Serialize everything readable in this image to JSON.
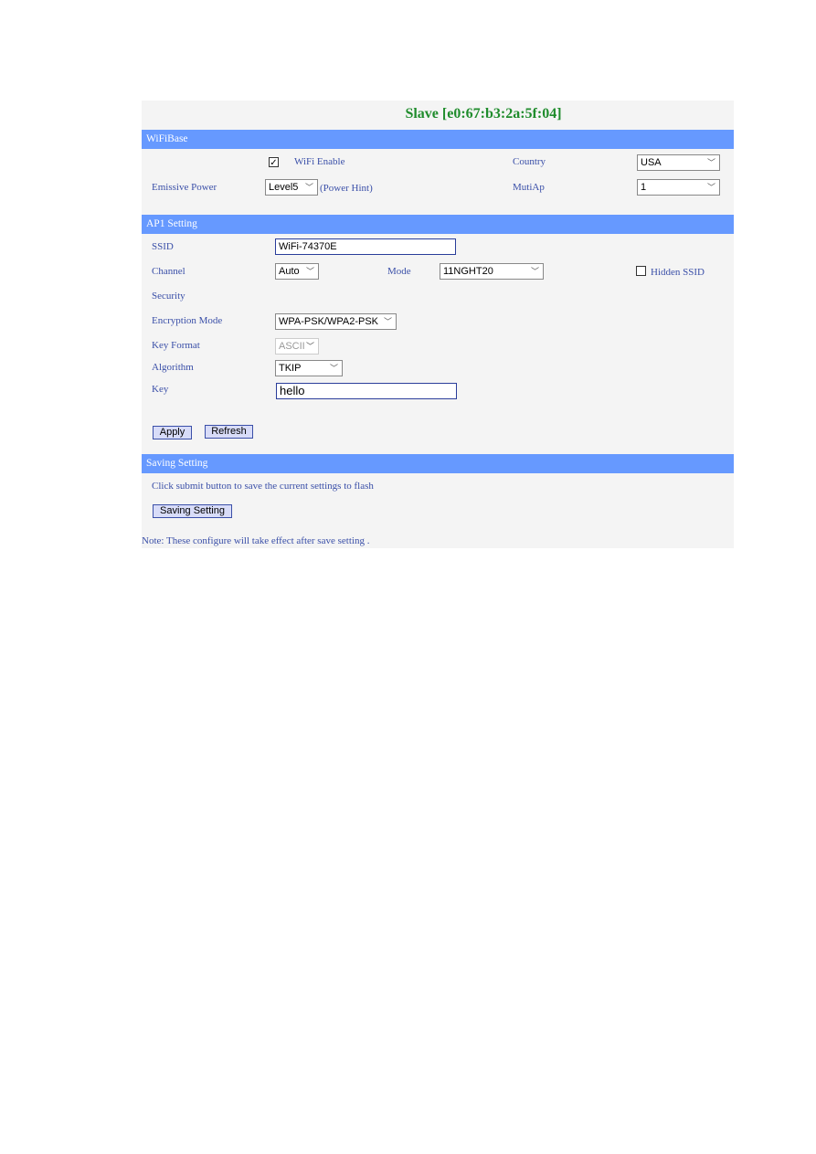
{
  "title": "Slave  [e0:67:b3:2a:5f:04]",
  "wifibase": {
    "header": "WiFiBase",
    "wifi_enable_label": "WiFi Enable",
    "wifi_enable_checked": true,
    "country_label": "Country",
    "country_value": "USA",
    "power_label": "Emissive Power",
    "power_value": "Level5",
    "power_hint": "(Power Hint)",
    "multiap_label": "MutiAp",
    "multiap_value": "1"
  },
  "ap1": {
    "header": "AP1 Setting",
    "ssid_label": "SSID",
    "ssid_value": "WiFi-74370E",
    "channel_label": "Channel",
    "channel_value": "Auto",
    "mode_label": "Mode",
    "mode_value": "11NGHT20",
    "hidden_ssid_label": "Hidden SSID",
    "hidden_ssid_checked": false,
    "security_label": "Security",
    "encryption_label": "Encryption Mode",
    "encryption_value": "WPA-PSK/WPA2-PSK",
    "key_format_label": "Key Format",
    "key_format_value": "ASCII",
    "algorithm_label": "Algorithm",
    "algorithm_value": "TKIP",
    "key_label": "Key",
    "key_value": "hello",
    "apply_label": "Apply",
    "refresh_label": "Refresh"
  },
  "saving": {
    "header": "Saving Setting",
    "description": "Click submit button to save the current settings to flash",
    "button_label": "Saving Setting",
    "note": "Note: These configure will take effect after save setting ."
  }
}
